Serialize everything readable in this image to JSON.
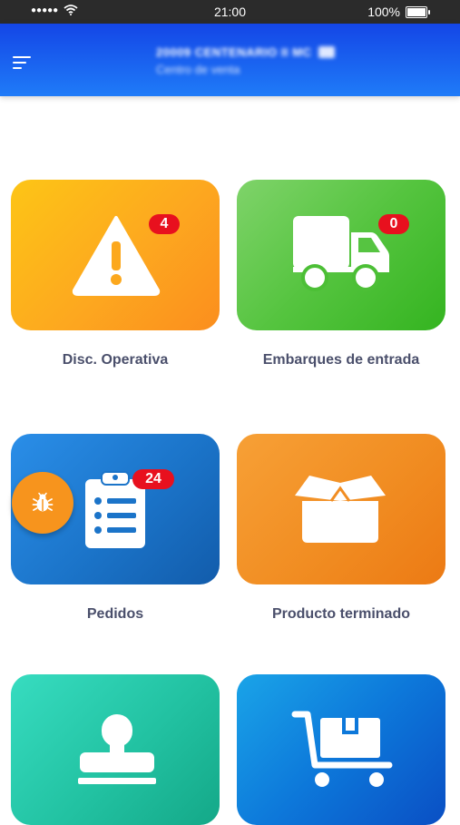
{
  "status_bar": {
    "signal": "●●●●●",
    "time": "21:00",
    "battery": "100%"
  },
  "header": {
    "title": "20009 CENTENARIO II MC",
    "subtitle": "Centro de venta"
  },
  "tiles": [
    {
      "label": "Disc. Operativa",
      "count": "4",
      "icon": "warning-icon",
      "color": "#f9a51a"
    },
    {
      "label": "Embarques de entrada",
      "count": "0",
      "icon": "truck-icon",
      "color": "#4cc33a"
    },
    {
      "label": "Pedidos",
      "count": "24",
      "icon": "clipboard-icon",
      "color": "#1b74c9"
    },
    {
      "label": "Producto terminado",
      "icon": "box-icon",
      "color": "#f08a1e"
    },
    {
      "icon": "stamp-icon",
      "color": "#24c4a2"
    },
    {
      "icon": "cart-icon",
      "color": "#0d5fd6"
    }
  ],
  "fab": {
    "icon": "bug-icon",
    "color": "#f7941d"
  }
}
